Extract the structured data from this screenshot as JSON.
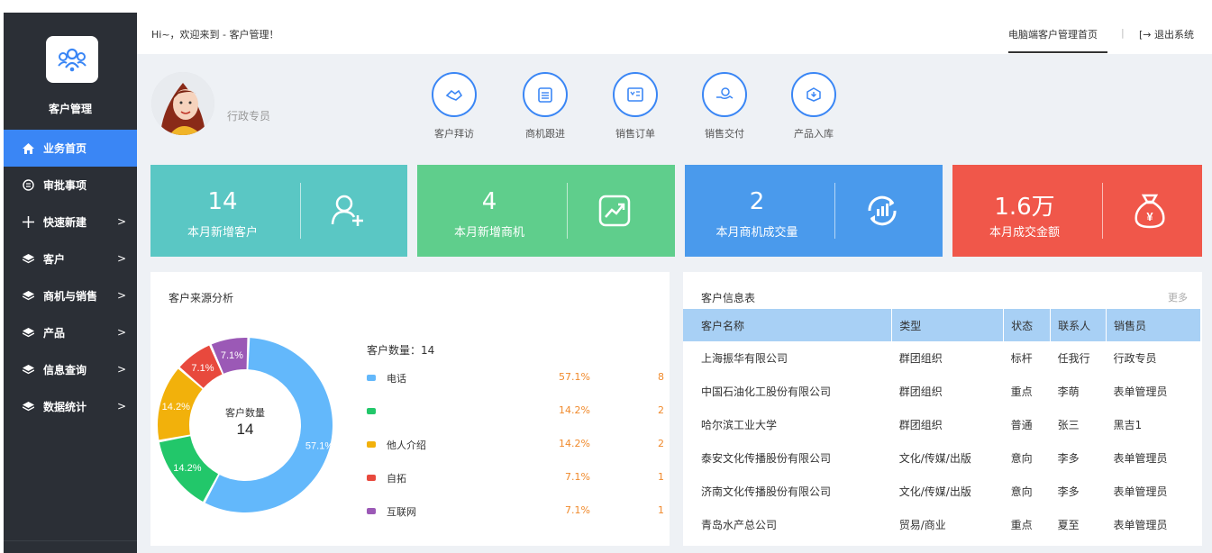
{
  "app": {
    "title": "客户管理"
  },
  "sidebar": {
    "items": [
      {
        "label": "业务首页",
        "icon": "home-icon",
        "active": true,
        "has_arrow": false
      },
      {
        "label": "审批事项",
        "icon": "list-circle-icon",
        "active": false,
        "has_arrow": false
      },
      {
        "label": "快速新建",
        "icon": "plus-icon",
        "active": false,
        "has_arrow": true
      },
      {
        "label": "客户",
        "icon": "layers-icon",
        "active": false,
        "has_arrow": true
      },
      {
        "label": "商机与销售",
        "icon": "layers-icon",
        "active": false,
        "has_arrow": true
      },
      {
        "label": "产品",
        "icon": "layers-icon",
        "active": false,
        "has_arrow": true
      },
      {
        "label": "信息查询",
        "icon": "layers-icon",
        "active": false,
        "has_arrow": true
      },
      {
        "label": "数据统计",
        "icon": "layers-icon",
        "active": false,
        "has_arrow": true
      }
    ]
  },
  "topbar": {
    "greeting": "Hi~，欢迎来到 - 客户管理！",
    "home_link": "电脑端客户管理首页",
    "separator": "|",
    "exit_label": "退出系统"
  },
  "profile": {
    "role": "行政专员"
  },
  "quick_actions": [
    {
      "label": "客户拜访",
      "icon": "handshake-icon"
    },
    {
      "label": "商机跟进",
      "icon": "clipboard-icon"
    },
    {
      "label": "销售订单",
      "icon": "invoice-icon"
    },
    {
      "label": "销售交付",
      "icon": "hand-coin-icon"
    },
    {
      "label": "产品入库",
      "icon": "box-in-icon"
    }
  ],
  "stats": [
    {
      "value": "14",
      "label": "本月新增客户",
      "color": "#5ac7c4",
      "icon": "add-user-icon"
    },
    {
      "value": "4",
      "label": "本月新增商机",
      "color": "#5fce8c",
      "icon": "trend-chart-icon"
    },
    {
      "value": "2",
      "label": "本月商机成交量",
      "color": "#4a9aec",
      "icon": "cycle-bars-icon"
    },
    {
      "value": "1.6万",
      "label": "本月成交金额",
      "color": "#f0574a",
      "icon": "money-bag-icon"
    }
  ],
  "source_panel": {
    "title": "客户来源分析",
    "center_label": "客户数量",
    "center_value": "14",
    "legend_title": "客户数量：14"
  },
  "chart_data": {
    "type": "pie",
    "title": "客户来源分析",
    "total_label": "客户数量",
    "total": 14,
    "slices": [
      {
        "name": "电话",
        "value": 8,
        "percent": "57.1%",
        "color": "#63b8fb"
      },
      {
        "name": "",
        "value": 2,
        "percent": "14.2%",
        "color": "#22c76a"
      },
      {
        "name": "他人介绍",
        "value": 2,
        "percent": "14.2%",
        "color": "#f2b10b"
      },
      {
        "name": "自拓",
        "value": 1,
        "percent": "7.1%",
        "color": "#e8493d"
      },
      {
        "name": "互联网",
        "value": 1,
        "percent": "7.1%",
        "color": "#9b59b6"
      }
    ]
  },
  "info_table": {
    "title": "客户信息表",
    "more": "更多",
    "headers": [
      "客户名称",
      "类型",
      "状态",
      "联系人",
      "销售员"
    ],
    "rows": [
      [
        "上海振华有限公司",
        "群团组织",
        "标杆",
        "任我行",
        "行政专员"
      ],
      [
        "中国石油化工股份有限公司",
        "群团组织",
        "重点",
        "李萌",
        "表单管理员"
      ],
      [
        "哈尔滨工业大学",
        "群团组织",
        "普通",
        "张三",
        "黑吉1"
      ],
      [
        "泰安文化传播股份有限公司",
        "文化/传媒/出版",
        "意向",
        "李多",
        "表单管理员"
      ],
      [
        "济南文化传播股份有限公司",
        "文化/传媒/出版",
        "意向",
        "李多",
        "表单管理员"
      ],
      [
        "青岛水产总公司",
        "贸易/商业",
        "重点",
        "夏至",
        "表单管理员"
      ]
    ]
  }
}
